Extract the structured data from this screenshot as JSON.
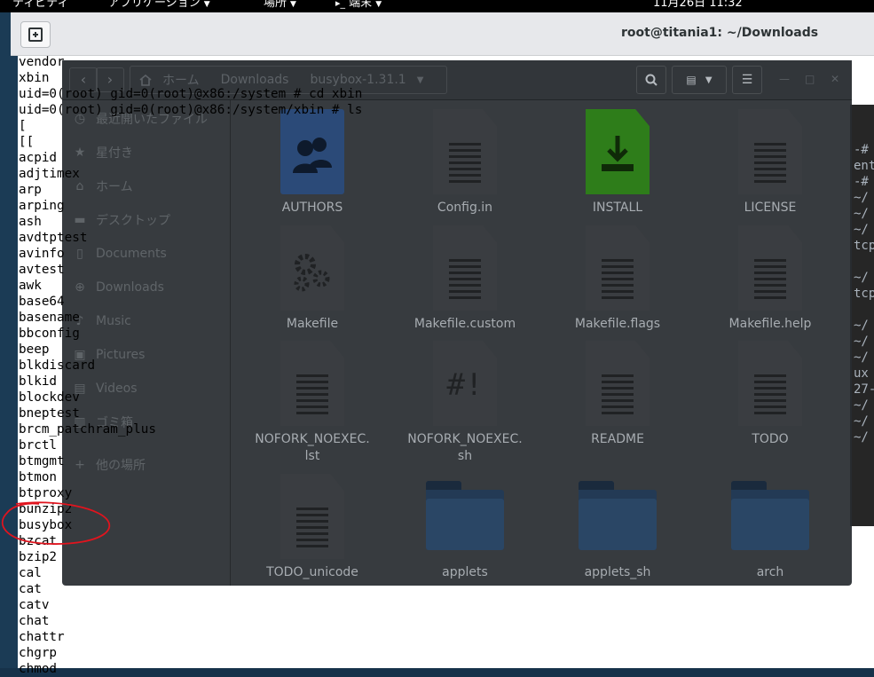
{
  "topbar": {
    "activities": "ティビティ",
    "applications": "アプリケーション",
    "places": "場所",
    "terminal_menu": "端末",
    "clock": "11月26日  11:32"
  },
  "terminal": {
    "title": "root@titania1: ~/Downloads",
    "lines": [
      "vendor",
      "xbin",
      "uid=0(root) gid=0(root)@x86:/system # cd xbin",
      "uid=0(root) gid=0(root)@x86:/system/xbin # ls",
      "[",
      "[[",
      "acpid",
      "adjtimex",
      "arp",
      "arping",
      "ash",
      "avdtptest",
      "avinfo",
      "avtest",
      "awk",
      "base64",
      "basename",
      "bbconfig",
      "beep",
      "blkdiscard",
      "blkid",
      "blockdev",
      "bneptest",
      "brcm_patchram_plus",
      "brctl",
      "btmgmt",
      "btmon",
      "btproxy",
      "bunzip2",
      "busybox",
      "bzcat",
      "bzip2",
      "cal",
      "cat",
      "catv",
      "chat",
      "chattr",
      "chgrp",
      "chmod"
    ]
  },
  "back_terminal": {
    "lines": [
      "-#",
      "ent",
      "-#",
      "~/",
      "~/",
      "~/",
      "tcp",
      "",
      "~/",
      "tcp",
      "",
      "~/",
      "~/",
      "~/",
      "ux",
      "27-",
      "~/",
      "~/",
      "~/"
    ]
  },
  "file_manager": {
    "path": {
      "home": "ホーム",
      "downloads": "Downloads",
      "current": "busybox-1.31.1"
    },
    "sidebar": [
      {
        "label": "最近開いたファイル",
        "icon": "clock-icon",
        "glyph": "◷"
      },
      {
        "label": "星付き",
        "icon": "star-icon",
        "glyph": "★"
      },
      {
        "label": "ホーム",
        "icon": "home-icon",
        "glyph": "⌂"
      },
      {
        "label": "デスクトップ",
        "icon": "desktop-icon",
        "glyph": "▬"
      },
      {
        "label": "Documents",
        "icon": "document-icon",
        "glyph": "▯"
      },
      {
        "label": "Downloads",
        "icon": "download-icon",
        "glyph": "⊕"
      },
      {
        "label": "Music",
        "icon": "music-icon",
        "glyph": "♪"
      },
      {
        "label": "Pictures",
        "icon": "pictures-icon",
        "glyph": "▣"
      },
      {
        "label": "Videos",
        "icon": "videos-icon",
        "glyph": "▤"
      },
      {
        "label": "ゴミ箱",
        "icon": "trash-icon",
        "glyph": "▥"
      },
      {
        "label": "他の場所",
        "icon": "plus-icon",
        "glyph": "+"
      }
    ],
    "files": [
      {
        "name": "AUTHORS",
        "kind": "authors"
      },
      {
        "name": "Config.in",
        "kind": "text"
      },
      {
        "name": "INSTALL",
        "kind": "install"
      },
      {
        "name": "LICENSE",
        "kind": "text"
      },
      {
        "name": "Makefile",
        "kind": "makefile"
      },
      {
        "name": "Makefile.custom",
        "kind": "text"
      },
      {
        "name": "Makefile.flags",
        "kind": "text"
      },
      {
        "name": "Makefile.help",
        "kind": "text"
      },
      {
        "name": "NOFORK_NOEXEC.\nlst",
        "kind": "text"
      },
      {
        "name": "NOFORK_NOEXEC.\nsh",
        "kind": "script"
      },
      {
        "name": "README",
        "kind": "text"
      },
      {
        "name": "TODO",
        "kind": "text"
      },
      {
        "name": "TODO_unicode",
        "kind": "text"
      },
      {
        "name": "applets",
        "kind": "folder"
      },
      {
        "name": "applets_sh",
        "kind": "folder"
      },
      {
        "name": "arch",
        "kind": "folder"
      }
    ],
    "script_glyph": "#!"
  },
  "colors": {
    "annotation_red": "#e0141e",
    "install_green": "#2e7d1a",
    "authors_blue": "#2b4a78"
  }
}
